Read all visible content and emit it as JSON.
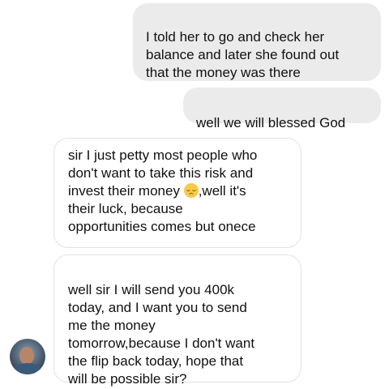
{
  "messages": [
    {
      "direction": "sent",
      "text": "I told her to go and check her\nbalance and later she found out\nthat the money was there"
    },
    {
      "direction": "sent",
      "text": "well we will blessed God"
    },
    {
      "direction": "received",
      "text_before_emoji": "sir I just petty most people who\ndon't want to take this risk and\ninvest their money ",
      "emoji": "pensive-face",
      "text_after_emoji": ",well it's\ntheir luck, because\nopportunities comes but onece"
    },
    {
      "direction": "received",
      "text": "well sir I will send you  400k\ntoday, and I want you to send\nme the money\ntomorrow,because I don't want\nthe flip back today, hope that\nwill be possible sir?"
    }
  ],
  "colors": {
    "sent_bubble": "#ebebeb",
    "received_border": "#e2e2e2",
    "text": "#111111"
  },
  "avatar": {
    "icon": "contact-avatar"
  }
}
